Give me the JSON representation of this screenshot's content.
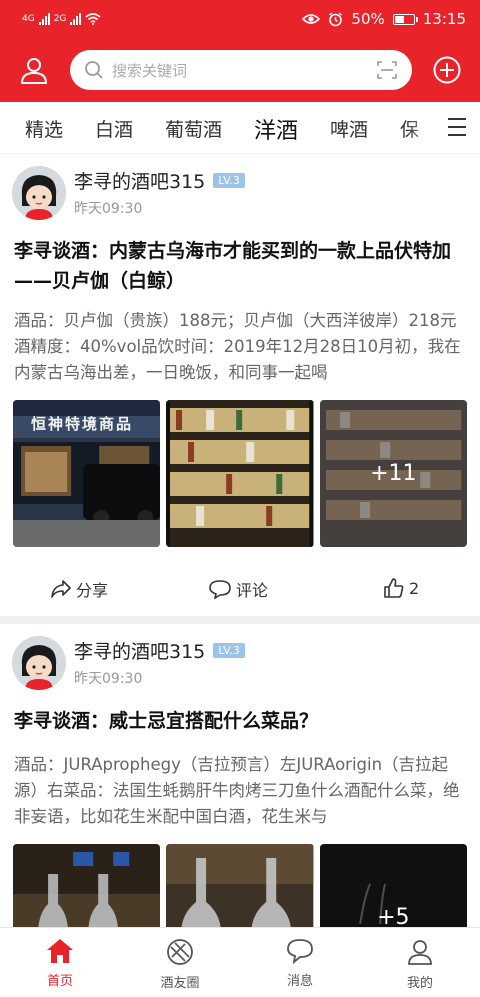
{
  "status_bar": {
    "network_1": "4G",
    "network_2": "2G",
    "battery": "50%",
    "battery_level": 0.5,
    "time": "13:15"
  },
  "header": {
    "search_placeholder": "搜索关键词",
    "icons": [
      "user-icon",
      "search-icon",
      "scan-icon",
      "add-icon"
    ],
    "accent_color": "#e8232a"
  },
  "tabs": [
    {
      "label": "精选",
      "active": false
    },
    {
      "label": "白酒",
      "active": false
    },
    {
      "label": "葡萄酒",
      "active": false
    },
    {
      "label": "洋酒",
      "active": true
    },
    {
      "label": "啤酒",
      "active": false
    },
    {
      "label": "保",
      "active": false
    }
  ],
  "posts": [
    {
      "author": "李寻的酒吧315",
      "level": "LV.3",
      "time": "昨天09:30",
      "title": "李寻谈酒：内蒙古乌海市才能买到的一款上品伏特加——贝卢伽（白鲸）",
      "body": "酒品：贝卢伽（贵族）188元；贝卢伽（大西洋彼岸）218元酒精度：40%vol品饮时间：2019年12月28日10月初，我在内蒙古乌海出差，一日晚饭，和同事一起喝",
      "storefront_sign": "恒神特境商品",
      "more_images": "+11",
      "share_label": "分享",
      "comment_label": "评论",
      "like_count": "2"
    },
    {
      "author": "李寻的酒吧315",
      "level": "LV.3",
      "time": "昨天09:30",
      "title": "李寻谈酒：威士忌宜搭配什么菜品？",
      "body": "酒品：JURAprophegy（吉拉预言）左JURAorigin（吉拉起源）右菜品：法国生蚝鹅肝牛肉烤三刀鱼什么酒配什么菜，绝非妄语，比如花生米配中国白酒，花生米与",
      "more_images": "+5"
    }
  ],
  "bottom_nav": [
    {
      "label": "首页",
      "icon": "home-icon",
      "active": true
    },
    {
      "label": "酒友圈",
      "icon": "circle-icon",
      "active": false
    },
    {
      "label": "消息",
      "icon": "message-icon",
      "active": false
    },
    {
      "label": "我的",
      "icon": "profile-icon",
      "active": false
    }
  ]
}
